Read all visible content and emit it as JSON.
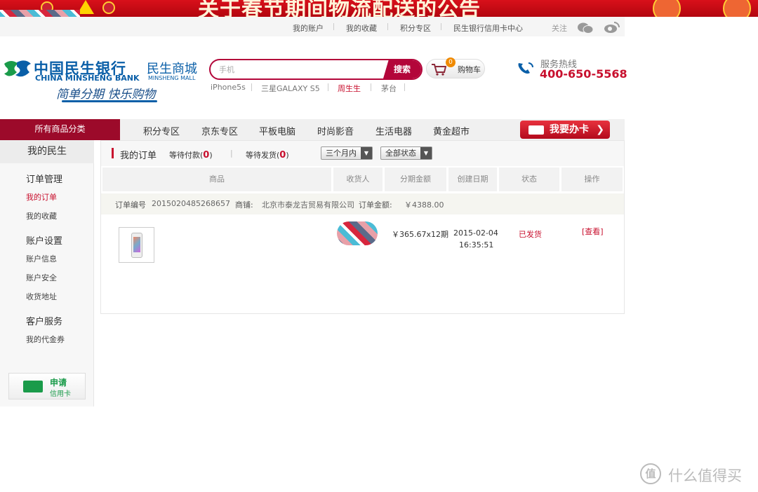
{
  "banner": {
    "text": "关于春节期间物流配送的公告"
  },
  "toplinks": [
    "我的账户",
    "我的收藏",
    "积分专区",
    "民生银行信用卡中心"
  ],
  "follow_label": "关注",
  "logo": {
    "cn": "中国民生银行",
    "en": "CHINA MINSHENG BANK",
    "mall_cn": "民生商城",
    "mall_en": "MINSHENG MALL",
    "slogan": "简单分期 快乐购物"
  },
  "search": {
    "placeholder": "手机",
    "button": "搜索",
    "hotwords": [
      "iPhone5s",
      "三星GALAXY S5",
      "周生生",
      "茅台"
    ]
  },
  "cart": {
    "count": "0",
    "label": "购物车"
  },
  "hotline": {
    "title": "服务热线",
    "number": "400-650-5568"
  },
  "nav": {
    "all": "所有商品分类",
    "items": [
      "积分专区",
      "京东专区",
      "平板电脑",
      "时尚影音",
      "生活电器",
      "黄金超市"
    ],
    "apply_card": "我要办卡"
  },
  "sidebar": {
    "title": "我的民生",
    "groups": [
      {
        "label": "订单管理",
        "items": [
          "我的订单",
          "我的收藏"
        ]
      },
      {
        "label": "账户设置",
        "items": [
          "账户信息",
          "账户安全",
          "收货地址"
        ]
      },
      {
        "label": "客户服务",
        "items": [
          "我的代金券"
        ]
      }
    ],
    "apply_credit": {
      "line1": "申请",
      "line2": "信用卡"
    }
  },
  "orders": {
    "tab": "我的订单",
    "pending_pay_label": "等待付款(",
    "pending_pay_count": "0",
    "pending_ship_label": "等待发货(",
    "pending_ship_count": "0",
    "close_paren": ")",
    "divider": "|",
    "range_filter": "三个月内",
    "status_filter": "全部状态",
    "columns": [
      "商品",
      "收货人",
      "分期金额",
      "创建日期",
      "状态",
      "操作"
    ],
    "order_no_label": "订单编号",
    "order_no": "2015020485268657",
    "shop_label": "商铺:",
    "shop": "北京市泰龙吉贸易有限公司",
    "amount_label": "订单金额:",
    "amount": "￥4388.00",
    "installment": "￥365.67x12期",
    "created_date": "2015-02-04",
    "created_time": "16:35:51",
    "status": "已发货",
    "action": "[查看]"
  },
  "watermark": {
    "logo": "值",
    "text": "什么值得买"
  }
}
